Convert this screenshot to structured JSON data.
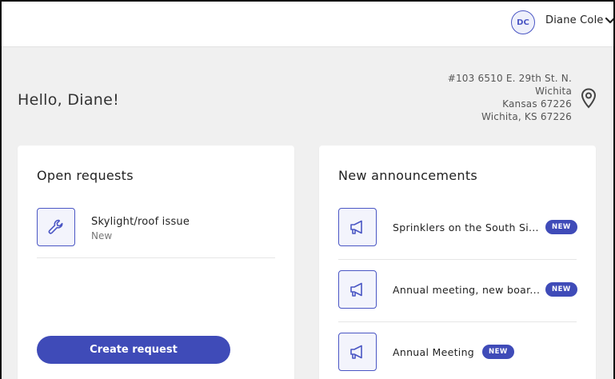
{
  "header": {
    "avatar_initials": "DC",
    "user_name": "Diane Cole"
  },
  "greeting": "Hello, Diane!",
  "address": {
    "line1": "#103 6510 E. 29th St. N.",
    "line2": "Wichita",
    "line3": "Kansas 67226",
    "line4": "Wichita, KS 67226"
  },
  "open_requests": {
    "title": "Open requests",
    "items": [
      {
        "title": "Skylight/roof issue",
        "status": "New",
        "icon": "wrench-icon"
      }
    ],
    "create_label": "Create request"
  },
  "announcements": {
    "title": "New announcements",
    "items": [
      {
        "title": "Sprinklers on the South Si...",
        "badge": "NEW",
        "icon": "megaphone-icon"
      },
      {
        "title": "Annual meeting, new boar...",
        "badge": "NEW",
        "icon": "megaphone-icon"
      },
      {
        "title": "Annual Meeting",
        "badge": "NEW",
        "icon": "megaphone-icon"
      }
    ]
  },
  "colors": {
    "accent": "#3f4bb8",
    "background": "#f0f0f0",
    "card": "#ffffff"
  }
}
